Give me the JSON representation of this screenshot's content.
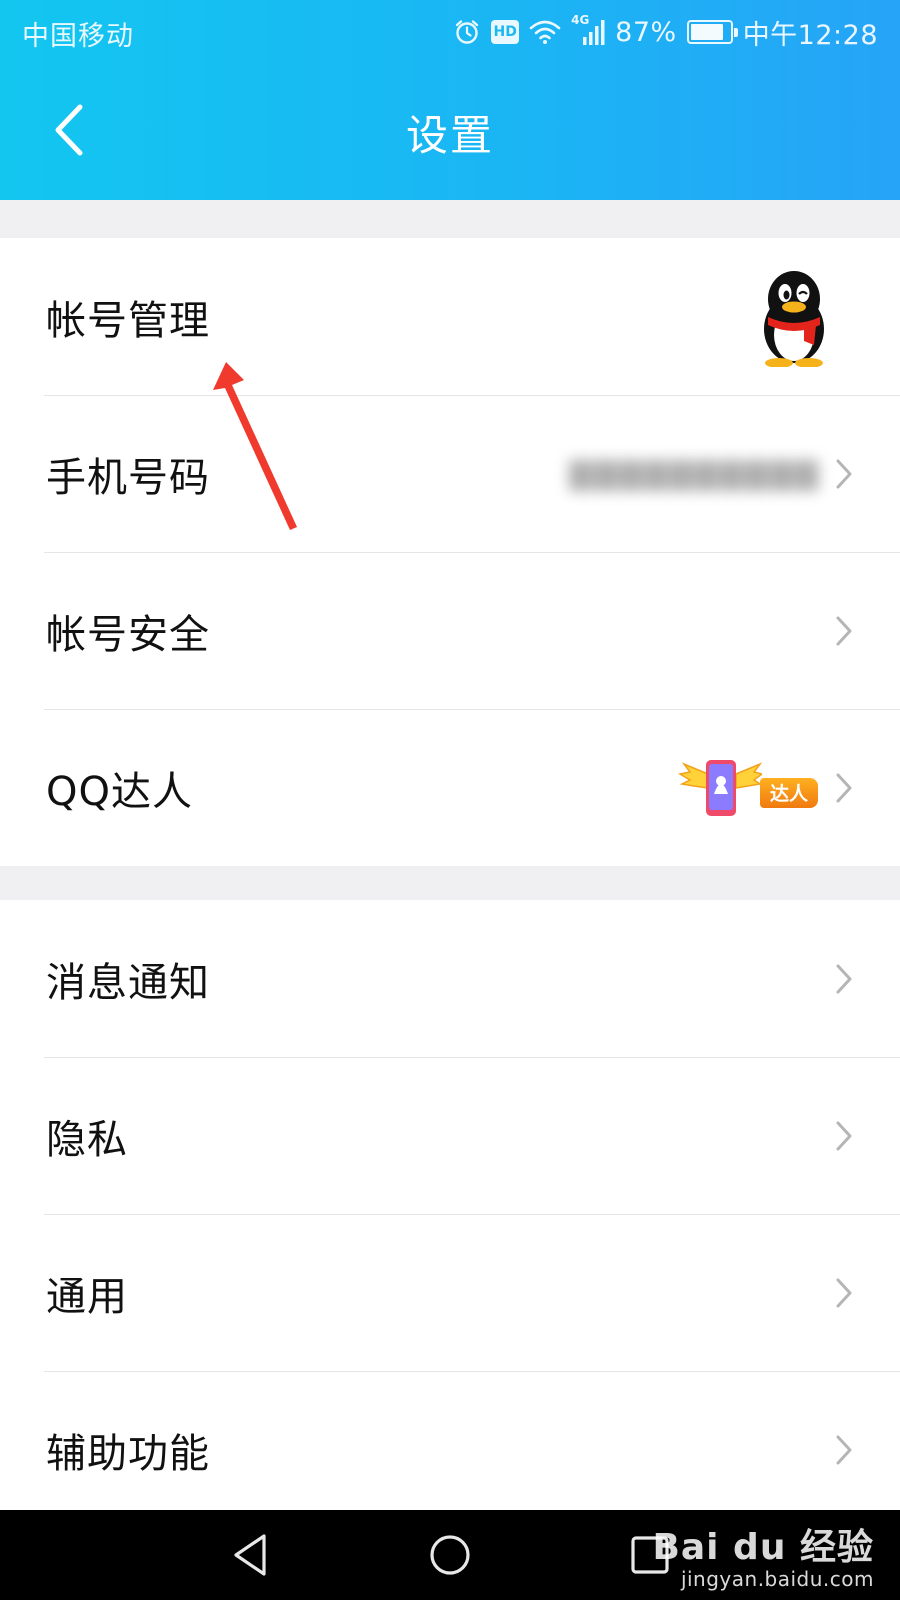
{
  "status_bar": {
    "carrier": "中国移动",
    "network_badge": "HD",
    "signal_label": "4G",
    "battery_percent": "87%",
    "battery_level": 0.87,
    "time": "中午12:28"
  },
  "header": {
    "title": "设置",
    "back_icon": "chevron-left-icon",
    "gradient_start": "#13c6f0",
    "gradient_end": "#26a4f7"
  },
  "groups": [
    {
      "items": [
        {
          "label": "帐号管理",
          "accessory": "qq-penguin-avatar"
        },
        {
          "label": "手机号码",
          "value": "▇▇▇▇▇▇▇▇▇▇",
          "accessory": "chevron-right-icon"
        },
        {
          "label": "帐号安全",
          "accessory": "chevron-right-icon"
        },
        {
          "label": "QQ达人",
          "badge_text": "达人",
          "accessory": "chevron-right-icon"
        }
      ]
    },
    {
      "items": [
        {
          "label": "消息通知",
          "accessory": "chevron-right-icon"
        },
        {
          "label": "隐私",
          "accessory": "chevron-right-icon"
        },
        {
          "label": "通用",
          "accessory": "chevron-right-icon"
        },
        {
          "label": "辅助功能",
          "accessory": "chevron-right-icon"
        }
      ]
    }
  ],
  "nav_bar": {
    "back_icon": "triangle-back-icon",
    "home_icon": "circle-home-icon",
    "recent_icon": "square-recents-icon"
  },
  "watermark": {
    "logo": "Bai du 经验",
    "url": "jingyan.baidu.com"
  },
  "colors": {
    "accent": "#1ab6f4",
    "list_background": "#ffffff",
    "page_background": "#f0f0f3",
    "annotation_arrow": "#f03a2e",
    "chevron": "#b5b5b5"
  }
}
